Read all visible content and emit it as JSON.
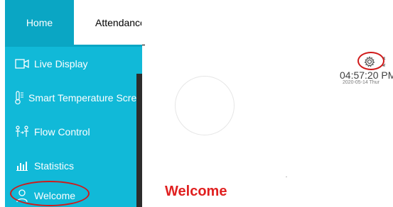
{
  "tabs": {
    "home": "Home",
    "attendance": "Attendance"
  },
  "sidebar": {
    "items": [
      {
        "label": "Live Display",
        "icon": "video-icon"
      },
      {
        "label": "Smart Temperature Screening",
        "icon": "thermometer-icon"
      },
      {
        "label": "Flow Control",
        "icon": "people-flow-icon"
      },
      {
        "label": "Statistics",
        "icon": "bar-chart-icon"
      },
      {
        "label": "Welcome",
        "icon": "person-icon"
      }
    ]
  },
  "main": {
    "title": "Welcome"
  },
  "clock": {
    "time": "04:57:20 PM",
    "date": "2020-05-14 Thur"
  },
  "colors": {
    "sidebar": "#11b9d8",
    "header": "#0aa6c4",
    "highlight": "#d01a1a",
    "title": "#e02020"
  }
}
